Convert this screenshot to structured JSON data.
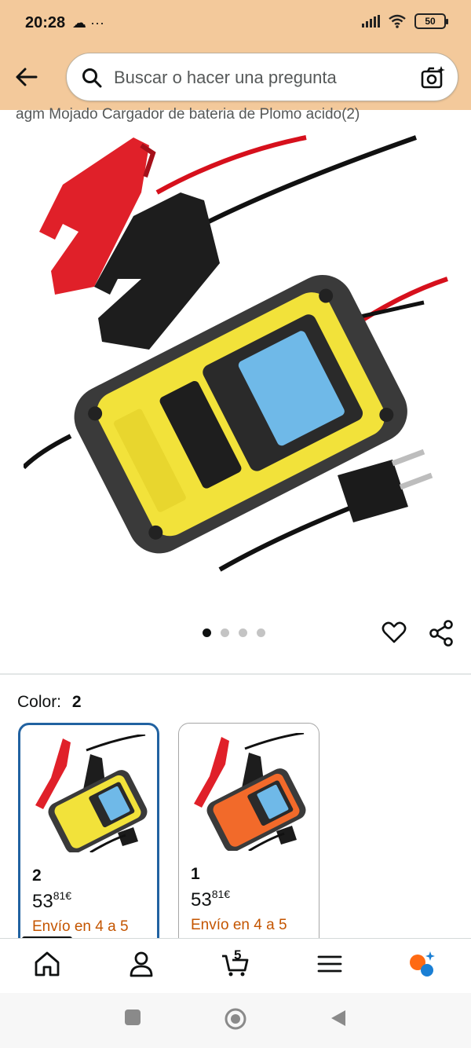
{
  "status_bar": {
    "time": "20:28",
    "left_icons": "☁ ···",
    "battery": "50"
  },
  "search": {
    "placeholder": "Buscar o hacer una pregunta"
  },
  "product": {
    "title_partial": "agm Mojado Cargador de bateria de Plomo acido(2)",
    "image_dots": 4,
    "active_dot": 0
  },
  "variant": {
    "label": "Color:",
    "selected": "2",
    "options": [
      {
        "name": "2",
        "price_whole": "53",
        "price_fraction": "81",
        "currency": "€",
        "shipping": "Envío en 4 a 5",
        "color": "#f2e23a"
      },
      {
        "name": "1",
        "price_whole": "53",
        "price_fraction": "81",
        "currency": "€",
        "shipping": "Envío en 4 a 5",
        "color": "#f26a2a"
      }
    ]
  },
  "bottom_nav": {
    "cart_count": "5"
  },
  "icons": [
    "back-arrow-icon",
    "search-icon",
    "camera-icon",
    "heart-icon",
    "share-icon",
    "home-icon",
    "account-icon",
    "cart-icon",
    "menu-icon",
    "ai-assistant-icon"
  ]
}
